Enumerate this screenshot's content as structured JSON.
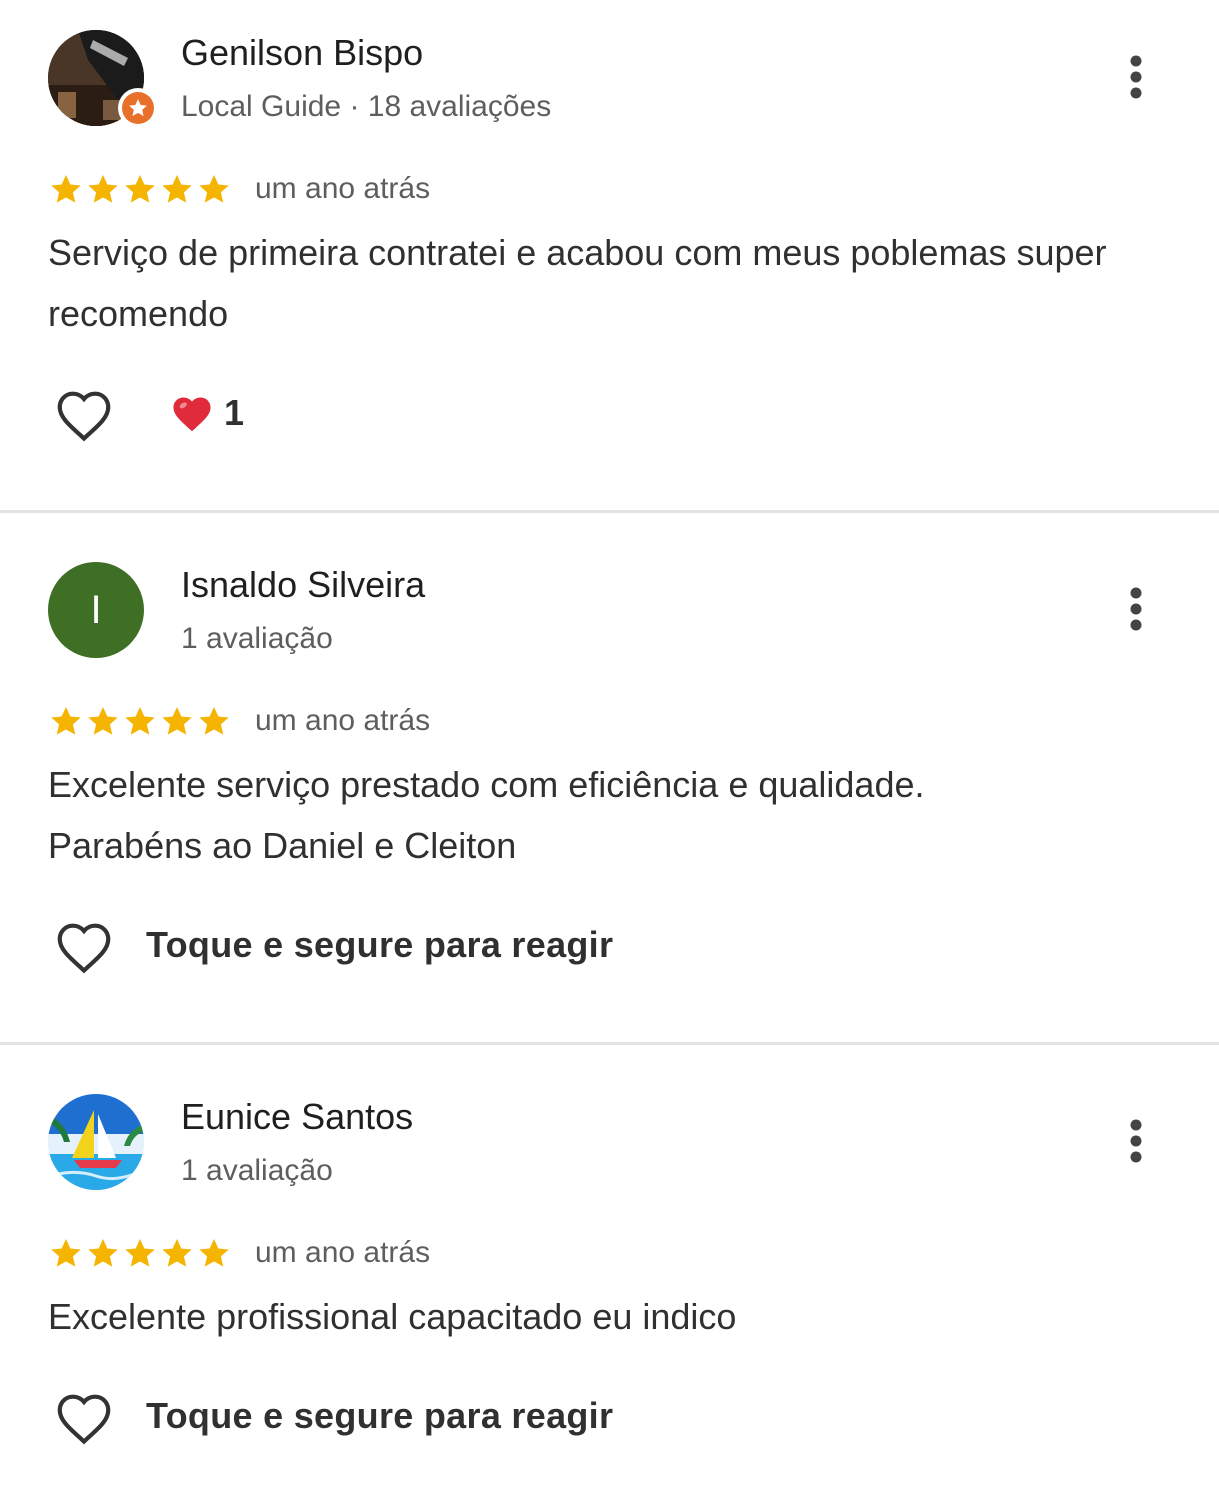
{
  "colors": {
    "star": "#F5B400",
    "avatar_isnaldo": "#3F6F24",
    "local_guide_badge": "#E8702A",
    "divider": "#E3E3E3",
    "reaction_heart": "#E02B3B"
  },
  "icons": {
    "more": "more-vert-icon",
    "heart_outline": "heart-outline-icon",
    "heart_reaction": "red-heart-emoji-icon",
    "star": "star-icon",
    "local_guide": "local-guide-star-badge-icon"
  },
  "reviews": [
    {
      "author": "Genilson Bispo",
      "meta": "Local Guide · 18 avaliações",
      "rating": 5,
      "time": "um ano atrás",
      "text": "Serviço de primeira  contratei e acabou com meus poblemas super recomendo",
      "reaction_count": "1"
    },
    {
      "author": "Isnaldo Silveira",
      "avatar_letter": "I",
      "meta": "1 avaliação",
      "rating": 5,
      "time": "um ano atrás",
      "text": "Excelente serviço prestado com eficiência e qualidade. Parabéns ao Daniel e Cleiton",
      "react_hint": "Toque e segure para reagir"
    },
    {
      "author": "Eunice Santos",
      "meta": "1 avaliação",
      "rating": 5,
      "time": "um ano atrás",
      "text": "Excelente profissional capacitado eu indico",
      "react_hint": "Toque e segure para reagir"
    }
  ]
}
